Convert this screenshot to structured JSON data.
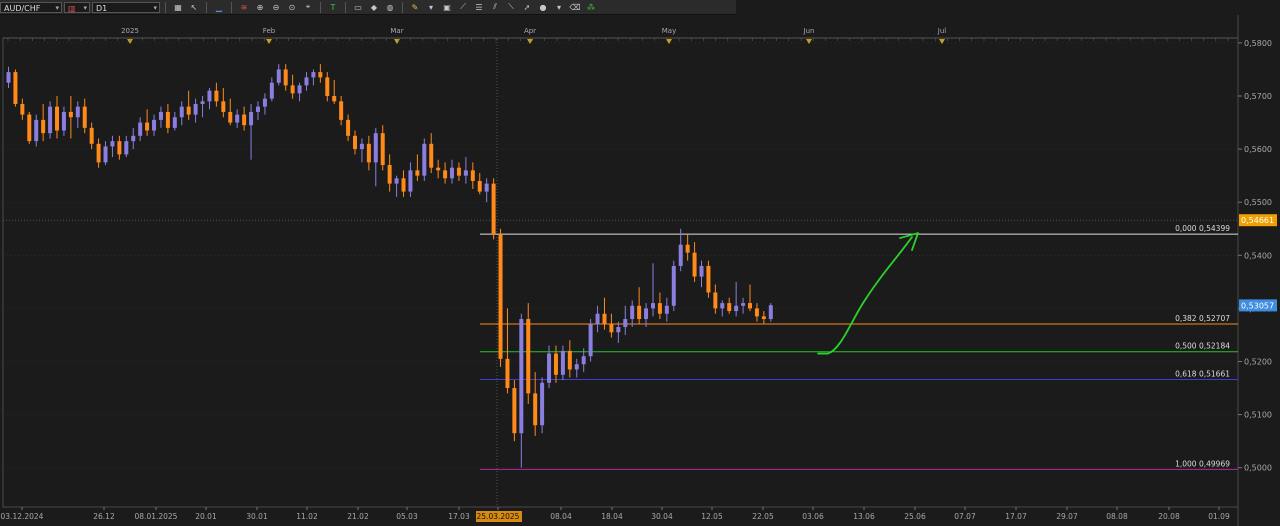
{
  "toolbar": {
    "symbol": "AUD/CHF",
    "timeframe": "D1",
    "icons": [
      "candles-icon",
      "cursor-icon",
      "line-icon",
      "zoom-in-icon",
      "zoom-out-icon",
      "zoom-reset-icon",
      "text-icon",
      "note-icon",
      "shape-icon",
      "pencil-icon",
      "screenshot-icon",
      "fibonacci-icon",
      "channel-icon",
      "trend-icon",
      "circle-icon",
      "eraser-icon",
      "indicators-icon"
    ]
  },
  "colors": {
    "background": "#1b1b1b",
    "bull_candle": "#8a7fe0",
    "bear_candle": "#ff8a1a",
    "grid": "#3a3a3a",
    "axis_text": "#a8a8a8",
    "fib_0": "#e0e0e0",
    "fib_382": "#ff8a1a",
    "fib_500": "#21c42a",
    "fib_618": "#3a3fd0",
    "fib_1000": "#b02aa0",
    "arrow": "#2bd12b",
    "current_price_badge": "#3e8de0",
    "marker_price_badge": "#f0a000"
  },
  "chart_data": {
    "type": "candlestick",
    "symbol": "AUD/CHF",
    "timeframe": "D1",
    "ylim": [
      0.4975,
      0.5845
    ],
    "y_ticks": [
      "0,5000",
      "0,5100",
      "0,5200",
      "0,5300",
      "0,5400",
      "0,5500",
      "0,5600",
      "0,5700",
      "0,5800"
    ],
    "x_tick_labels": [
      "03.12.2024",
      "26.12",
      "08.01.2025",
      "20.01",
      "30.01",
      "11.02",
      "21.02",
      "05.03",
      "17.03",
      "25.03.2025",
      "08.04",
      "18.04",
      "30.04",
      "12.05",
      "22.05",
      "03.06",
      "13.06",
      "25.06",
      "07.07",
      "17.07",
      "29.07",
      "08.08",
      "20.08",
      "01.09"
    ],
    "highlighted_x_label": "25.03.2025",
    "month_labels": [
      "2025",
      "Feb",
      "Mar",
      "Apr",
      "May",
      "Jun",
      "Jul"
    ],
    "current_price": "0,53057",
    "marker_price": "0,54661",
    "fibonacci": [
      {
        "level": "0,000",
        "price": "0,54399",
        "value": 0.54399
      },
      {
        "level": "0,382",
        "price": "0,52707",
        "value": 0.52707
      },
      {
        "level": "0,500",
        "price": "0,52184",
        "value": 0.52184
      },
      {
        "level": "0,618",
        "price": "0,51661",
        "value": 0.51661
      },
      {
        "level": "1,000",
        "price": "0,49969",
        "value": 0.49969
      }
    ],
    "candles": [
      [
        0.5725,
        0.5755,
        0.5715,
        0.5745
      ],
      [
        0.5745,
        0.575,
        0.568,
        0.5685
      ],
      [
        0.5685,
        0.5695,
        0.5655,
        0.5665
      ],
      [
        0.5665,
        0.567,
        0.561,
        0.5615
      ],
      [
        0.5615,
        0.5665,
        0.5605,
        0.5655
      ],
      [
        0.5655,
        0.5685,
        0.5615,
        0.563
      ],
      [
        0.563,
        0.569,
        0.562,
        0.568
      ],
      [
        0.568,
        0.57,
        0.562,
        0.5635
      ],
      [
        0.5635,
        0.568,
        0.5625,
        0.567
      ],
      [
        0.567,
        0.57,
        0.562,
        0.566
      ],
      [
        0.566,
        0.569,
        0.564,
        0.568
      ],
      [
        0.568,
        0.5695,
        0.563,
        0.564
      ],
      [
        0.564,
        0.565,
        0.56,
        0.561
      ],
      [
        0.561,
        0.562,
        0.5565,
        0.5575
      ],
      [
        0.5575,
        0.5615,
        0.557,
        0.5605
      ],
      [
        0.5605,
        0.5625,
        0.5585,
        0.5615
      ],
      [
        0.5615,
        0.5625,
        0.558,
        0.559
      ],
      [
        0.559,
        0.5625,
        0.5585,
        0.5615
      ],
      [
        0.5615,
        0.564,
        0.56,
        0.5625
      ],
      [
        0.5625,
        0.566,
        0.5615,
        0.565
      ],
      [
        0.565,
        0.5675,
        0.5625,
        0.5635
      ],
      [
        0.5635,
        0.5665,
        0.5625,
        0.5655
      ],
      [
        0.5655,
        0.568,
        0.564,
        0.567
      ],
      [
        0.567,
        0.5685,
        0.563,
        0.564
      ],
      [
        0.564,
        0.567,
        0.5635,
        0.566
      ],
      [
        0.566,
        0.569,
        0.5645,
        0.568
      ],
      [
        0.568,
        0.571,
        0.5655,
        0.5665
      ],
      [
        0.5665,
        0.5695,
        0.565,
        0.5685
      ],
      [
        0.5685,
        0.57,
        0.566,
        0.569
      ],
      [
        0.569,
        0.5715,
        0.5675,
        0.571
      ],
      [
        0.571,
        0.5725,
        0.568,
        0.569
      ],
      [
        0.569,
        0.5715,
        0.566,
        0.567
      ],
      [
        0.567,
        0.5695,
        0.5645,
        0.565
      ],
      [
        0.565,
        0.5675,
        0.564,
        0.5665
      ],
      [
        0.5665,
        0.568,
        0.5635,
        0.5645
      ],
      [
        0.5645,
        0.5685,
        0.558,
        0.567
      ],
      [
        0.567,
        0.569,
        0.5655,
        0.568
      ],
      [
        0.568,
        0.5705,
        0.5665,
        0.5695
      ],
      [
        0.5695,
        0.5735,
        0.569,
        0.5725
      ],
      [
        0.5725,
        0.576,
        0.572,
        0.575
      ],
      [
        0.575,
        0.576,
        0.571,
        0.572
      ],
      [
        0.572,
        0.574,
        0.5695,
        0.5705
      ],
      [
        0.5705,
        0.5725,
        0.569,
        0.572
      ],
      [
        0.572,
        0.5745,
        0.571,
        0.5735
      ],
      [
        0.5735,
        0.575,
        0.572,
        0.5745
      ],
      [
        0.5745,
        0.576,
        0.5725,
        0.5735
      ],
      [
        0.5735,
        0.5745,
        0.569,
        0.57
      ],
      [
        0.57,
        0.573,
        0.5685,
        0.569
      ],
      [
        0.569,
        0.57,
        0.5645,
        0.5655
      ],
      [
        0.5655,
        0.5665,
        0.5615,
        0.5625
      ],
      [
        0.5625,
        0.5635,
        0.559,
        0.56
      ],
      [
        0.56,
        0.562,
        0.5575,
        0.561
      ],
      [
        0.561,
        0.5625,
        0.556,
        0.5575
      ],
      [
        0.5575,
        0.564,
        0.553,
        0.563
      ],
      [
        0.563,
        0.5645,
        0.556,
        0.557
      ],
      [
        0.557,
        0.559,
        0.552,
        0.5535
      ],
      [
        0.5535,
        0.555,
        0.551,
        0.5545
      ],
      [
        0.5545,
        0.556,
        0.551,
        0.552
      ],
      [
        0.552,
        0.5575,
        0.551,
        0.556
      ],
      [
        0.556,
        0.559,
        0.554,
        0.555
      ],
      [
        0.555,
        0.562,
        0.554,
        0.561
      ],
      [
        0.561,
        0.563,
        0.5555,
        0.5565
      ],
      [
        0.5565,
        0.558,
        0.5545,
        0.556
      ],
      [
        0.556,
        0.5575,
        0.5535,
        0.5545
      ],
      [
        0.5545,
        0.558,
        0.5535,
        0.5565
      ],
      [
        0.5565,
        0.5575,
        0.554,
        0.555
      ],
      [
        0.555,
        0.5585,
        0.5535,
        0.556
      ],
      [
        0.556,
        0.5575,
        0.5525,
        0.554
      ],
      [
        0.554,
        0.5555,
        0.5515,
        0.552
      ],
      [
        0.552,
        0.5545,
        0.55,
        0.5535
      ],
      [
        0.5535,
        0.5545,
        0.543,
        0.544
      ],
      [
        0.544,
        0.545,
        0.519,
        0.5205
      ],
      [
        0.5205,
        0.53,
        0.514,
        0.515
      ],
      [
        0.515,
        0.5165,
        0.505,
        0.5065
      ],
      [
        0.5065,
        0.529,
        0.5,
        0.528
      ],
      [
        0.528,
        0.531,
        0.512,
        0.514
      ],
      [
        0.514,
        0.518,
        0.506,
        0.508
      ],
      [
        0.508,
        0.517,
        0.5065,
        0.516
      ],
      [
        0.516,
        0.523,
        0.515,
        0.5215
      ],
      [
        0.5215,
        0.523,
        0.516,
        0.5175
      ],
      [
        0.5175,
        0.523,
        0.5165,
        0.522
      ],
      [
        0.522,
        0.524,
        0.517,
        0.5185
      ],
      [
        0.5185,
        0.5205,
        0.517,
        0.5195
      ],
      [
        0.5195,
        0.5225,
        0.518,
        0.521
      ],
      [
        0.521,
        0.528,
        0.52,
        0.527
      ],
      [
        0.527,
        0.5305,
        0.5255,
        0.529
      ],
      [
        0.529,
        0.532,
        0.526,
        0.527
      ],
      [
        0.527,
        0.529,
        0.5245,
        0.5255
      ],
      [
        0.5255,
        0.5275,
        0.5235,
        0.5265
      ],
      [
        0.5265,
        0.5305,
        0.525,
        0.528
      ],
      [
        0.528,
        0.5315,
        0.5265,
        0.5305
      ],
      [
        0.5305,
        0.534,
        0.527,
        0.528
      ],
      [
        0.528,
        0.531,
        0.5265,
        0.53
      ],
      [
        0.53,
        0.5385,
        0.5285,
        0.531
      ],
      [
        0.531,
        0.533,
        0.528,
        0.529
      ],
      [
        0.529,
        0.532,
        0.5275,
        0.5305
      ],
      [
        0.5305,
        0.539,
        0.5295,
        0.538
      ],
      [
        0.538,
        0.545,
        0.537,
        0.542
      ],
      [
        0.542,
        0.544,
        0.539,
        0.5405
      ],
      [
        0.5405,
        0.5425,
        0.535,
        0.536
      ],
      [
        0.536,
        0.539,
        0.534,
        0.538
      ],
      [
        0.538,
        0.539,
        0.532,
        0.533
      ],
      [
        0.533,
        0.5345,
        0.529,
        0.53
      ],
      [
        0.53,
        0.5315,
        0.5285,
        0.531
      ],
      [
        0.531,
        0.532,
        0.529,
        0.5295
      ],
      [
        0.5295,
        0.535,
        0.5285,
        0.5305
      ],
      [
        0.5305,
        0.532,
        0.529,
        0.531
      ],
      [
        0.531,
        0.5345,
        0.5295,
        0.53
      ],
      [
        0.53,
        0.531,
        0.5275,
        0.5285
      ],
      [
        0.5285,
        0.5295,
        0.527,
        0.528
      ],
      [
        0.528,
        0.531,
        0.5275,
        0.5306
      ]
    ]
  }
}
